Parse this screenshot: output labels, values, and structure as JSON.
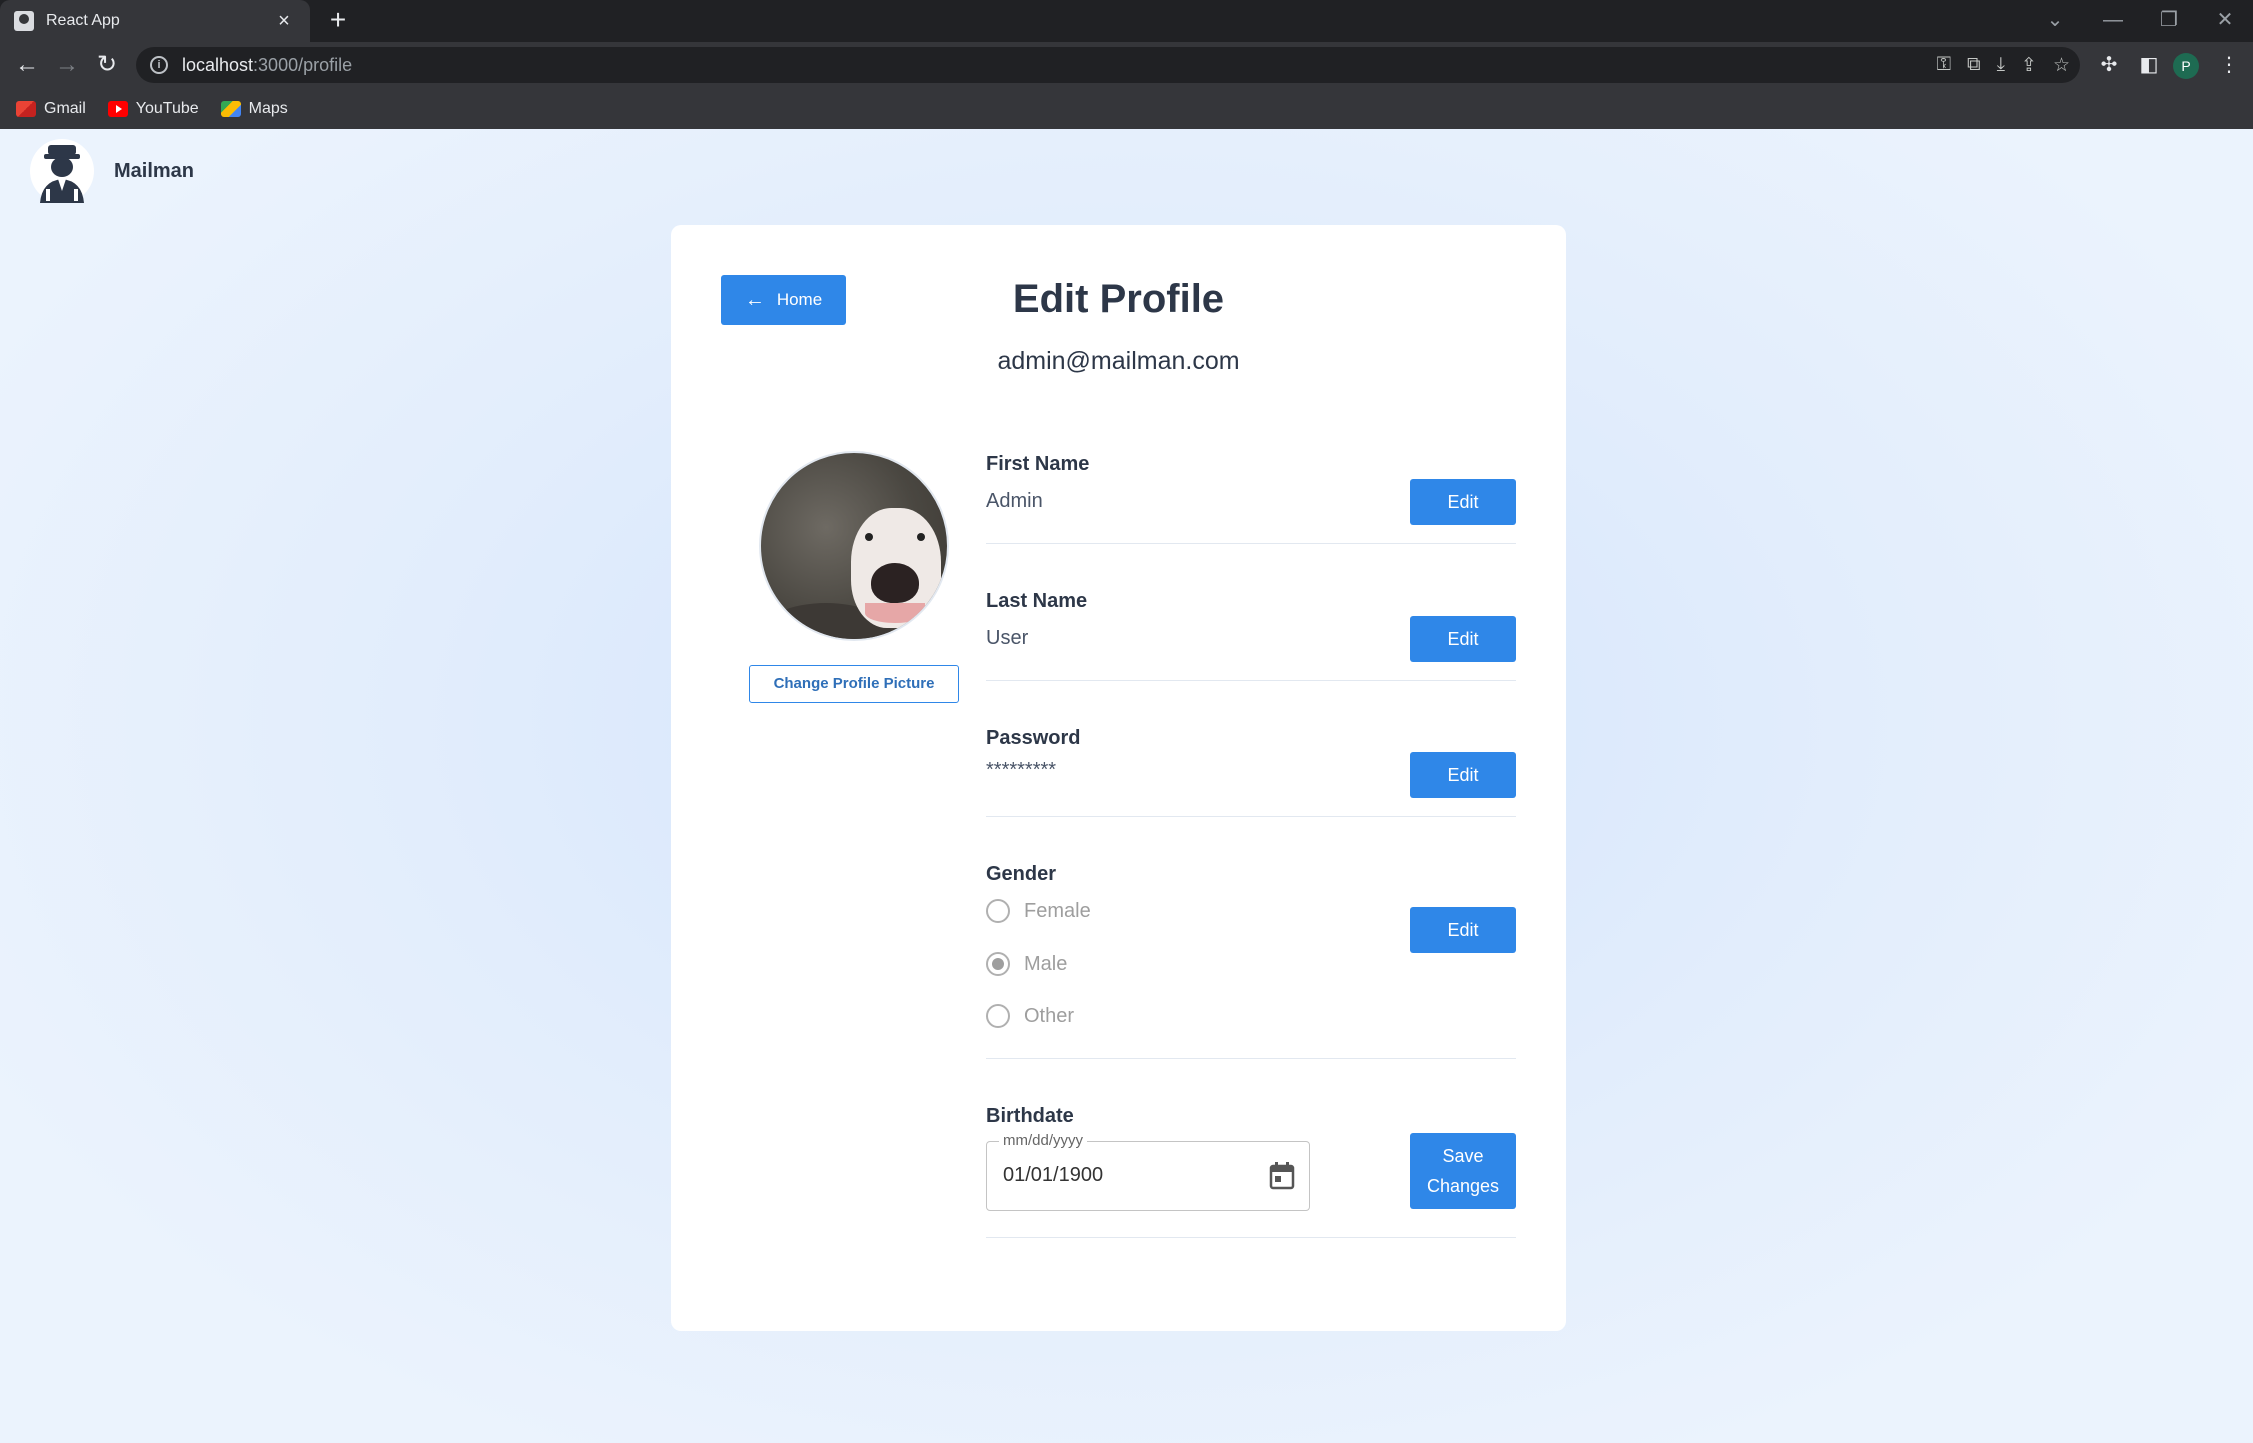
{
  "browser": {
    "tab_title": "React App",
    "tab_close": "×",
    "new_tab": "+",
    "url_host": "localhost",
    "url_path": ":3000/profile",
    "profile_initial": "P",
    "bookmarks": [
      {
        "label": "Gmail",
        "icon": "gmail-icon"
      },
      {
        "label": "YouTube",
        "icon": "youtube-icon"
      },
      {
        "label": "Maps",
        "icon": "maps-icon"
      }
    ]
  },
  "app": {
    "brand": "Mailman",
    "logo_icon": "mailman-logo-icon"
  },
  "profile": {
    "home_label": "Home",
    "title": "Edit Profile",
    "email": "admin@mailman.com",
    "change_picture_label": "Change Profile Picture",
    "fields": {
      "first_name": {
        "label": "First Name",
        "value": "Admin",
        "action": "Edit"
      },
      "last_name": {
        "label": "Last Name",
        "value": "User",
        "action": "Edit"
      },
      "password": {
        "label": "Password",
        "value": "*********",
        "action": "Edit"
      },
      "gender": {
        "label": "Gender",
        "action": "Edit",
        "options": [
          "Female",
          "Male",
          "Other"
        ],
        "selected": "Male"
      },
      "birthdate": {
        "label": "Birthdate",
        "placeholder": "mm/dd/yyyy",
        "value": "01/01/1900",
        "action_line1": "Save",
        "action_line2": "Changes"
      }
    }
  },
  "colors": {
    "primary": "#2f87e8",
    "text_dark": "#2d3748",
    "page_bg": "#e2edfc"
  }
}
